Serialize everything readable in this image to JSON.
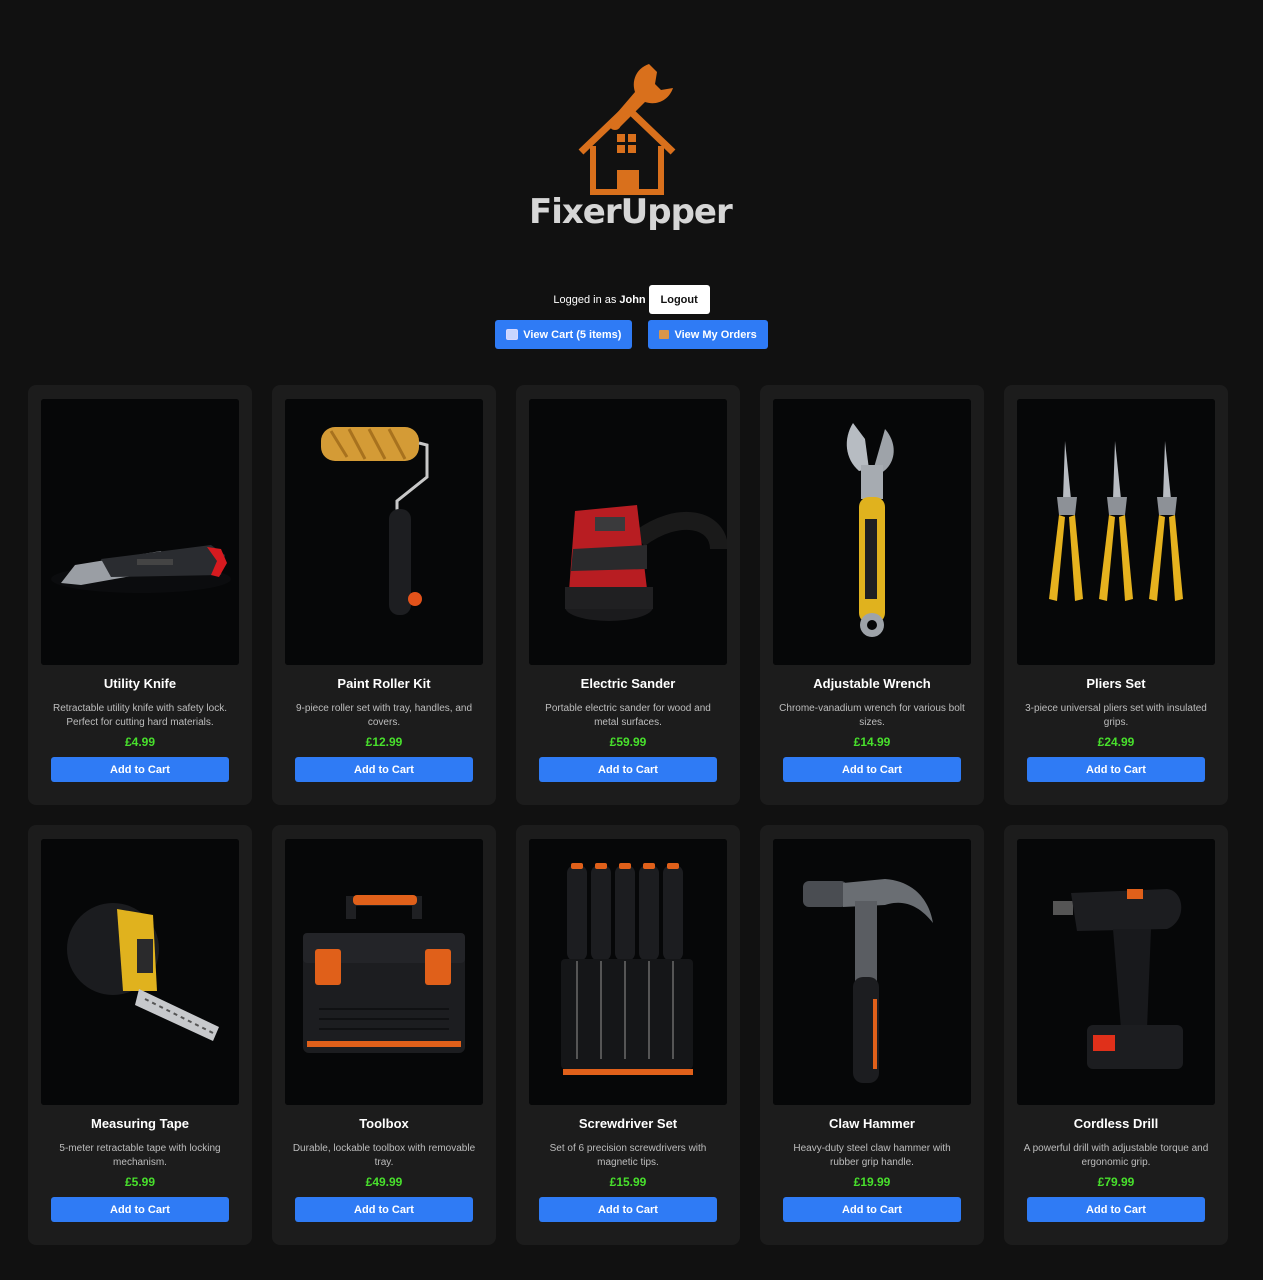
{
  "brand": {
    "name": "FixerUpper",
    "accent": "#d9701c"
  },
  "session": {
    "prefix": "Logged in as",
    "username": "John",
    "logout_label": "Logout"
  },
  "actions": {
    "cart_label": "View Cart (5 items)",
    "orders_label": "View My Orders"
  },
  "colors": {
    "background": "#111111",
    "card": "#1c1c1c",
    "button": "#2f7bf5",
    "price": "#48e02c"
  },
  "products": [
    {
      "name": "Utility Knife",
      "desc": "Retractable utility knife with safety lock. Perfect for cutting hard materials.",
      "price": "£4.99",
      "cta": "Add to Cart",
      "image_icon": "utility-knife-photo"
    },
    {
      "name": "Paint Roller Kit",
      "desc": "9-piece roller set with tray, handles, and covers.",
      "price": "£12.99",
      "cta": "Add to Cart",
      "image_icon": "paint-roller-photo"
    },
    {
      "name": "Electric Sander",
      "desc": "Portable electric sander for wood and metal surfaces.",
      "price": "£59.99",
      "cta": "Add to Cart",
      "image_icon": "electric-sander-photo"
    },
    {
      "name": "Adjustable Wrench",
      "desc": "Chrome-vanadium wrench for various bolt sizes.",
      "price": "£14.99",
      "cta": "Add to Cart",
      "image_icon": "adjustable-wrench-photo"
    },
    {
      "name": "Pliers Set",
      "desc": "3-piece universal pliers set with insulated grips.",
      "price": "£24.99",
      "cta": "Add to Cart",
      "image_icon": "pliers-photo"
    },
    {
      "name": "Measuring Tape",
      "desc": "5-meter retractable tape with locking mechanism.",
      "price": "£5.99",
      "cta": "Add to Cart",
      "image_icon": "measuring-tape-photo"
    },
    {
      "name": "Toolbox",
      "desc": "Durable, lockable toolbox with removable tray.",
      "price": "£49.99",
      "cta": "Add to Cart",
      "image_icon": "toolbox-photo"
    },
    {
      "name": "Screwdriver Set",
      "desc": "Set of 6 precision screwdrivers with magnetic tips.",
      "price": "£15.99",
      "cta": "Add to Cart",
      "image_icon": "screwdriver-set-photo"
    },
    {
      "name": "Claw Hammer",
      "desc": "Heavy-duty steel claw hammer with rubber grip handle.",
      "price": "£19.99",
      "cta": "Add to Cart",
      "image_icon": "claw-hammer-photo"
    },
    {
      "name": "Cordless Drill",
      "desc": "A powerful drill with adjustable torque and ergonomic grip.",
      "price": "£79.99",
      "cta": "Add to Cart",
      "image_icon": "cordless-drill-photo"
    }
  ]
}
